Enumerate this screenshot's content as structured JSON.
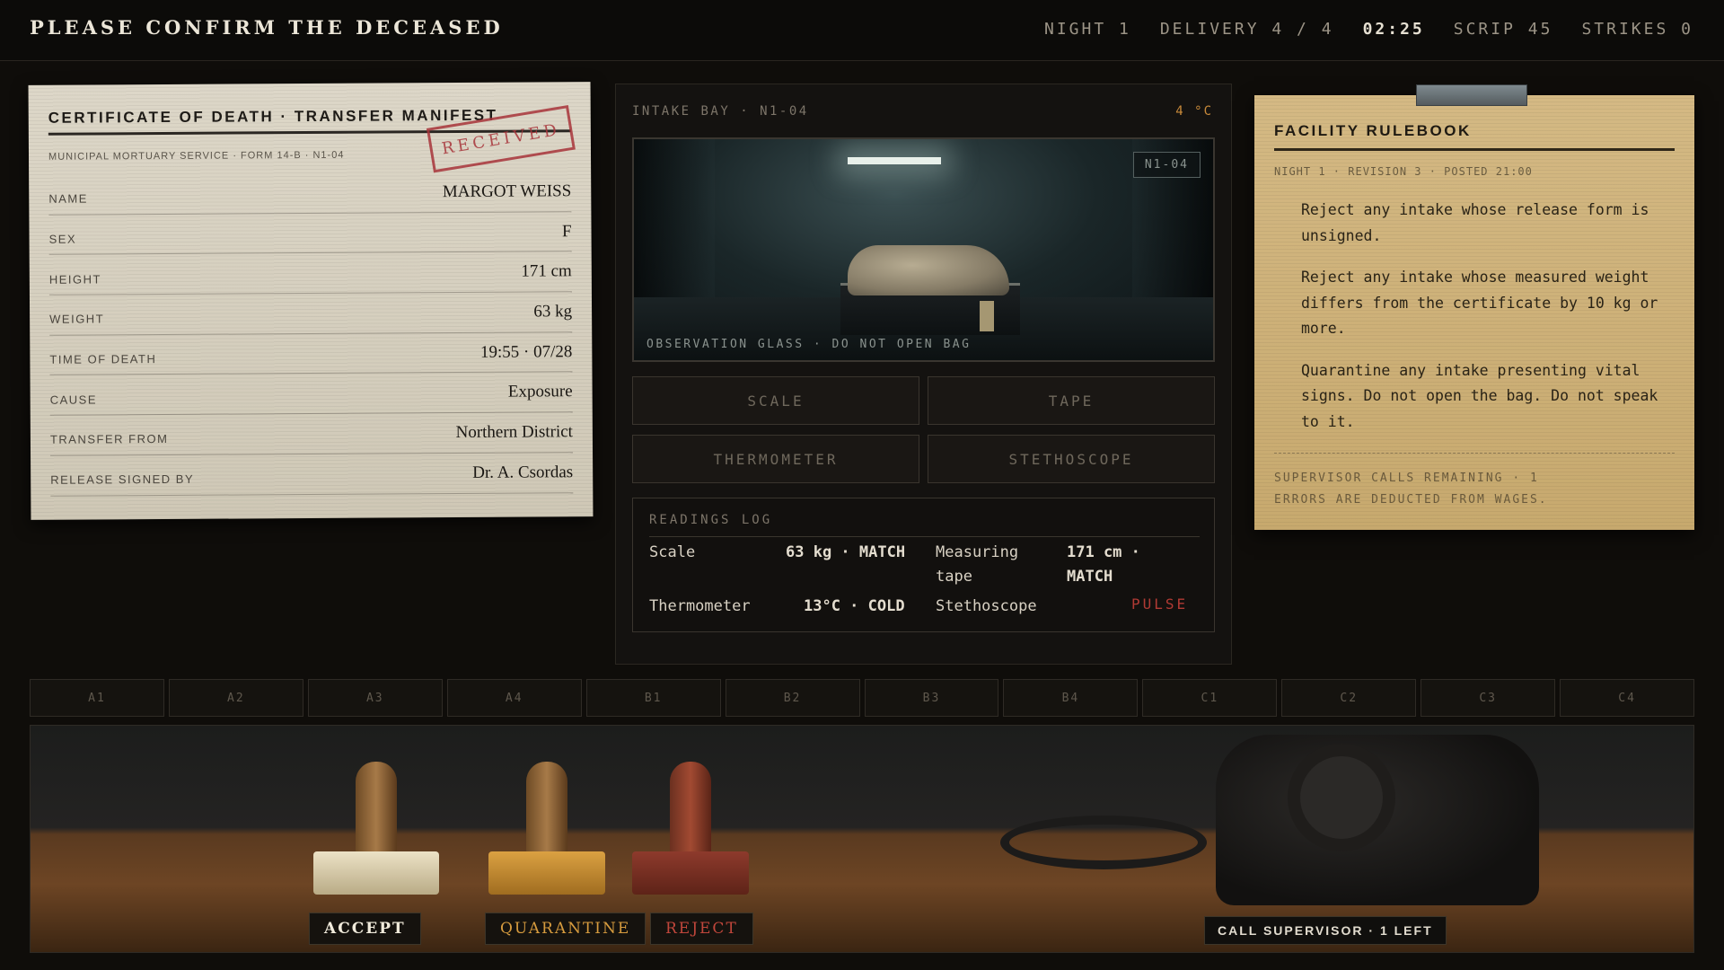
{
  "header": {
    "title": "PLEASE CONFIRM THE DECEASED",
    "night": "NIGHT 1",
    "delivery": "DELIVERY 4 / 4",
    "time": "02:25",
    "scrip": "SCRIP 45",
    "strikes": "STRIKES 0"
  },
  "certificate": {
    "heading": "CERTIFICATE OF DEATH · TRANSFER MANIFEST",
    "subheading": "MUNICIPAL MORTUARY SERVICE · FORM 14-B · N1-04",
    "stamp": "RECEIVED",
    "rows": [
      {
        "label": "NAME",
        "value": "MARGOT WEISS"
      },
      {
        "label": "SEX",
        "value": "F"
      },
      {
        "label": "HEIGHT",
        "value": "171 cm"
      },
      {
        "label": "WEIGHT",
        "value": "63 kg"
      },
      {
        "label": "TIME OF DEATH",
        "value": "19:55 · 07/28"
      },
      {
        "label": "CAUSE",
        "value": "Exposure"
      },
      {
        "label": "TRANSFER FROM",
        "value": "Northern District"
      },
      {
        "label": "RELEASE SIGNED BY",
        "value": "Dr. A. Csordas"
      }
    ]
  },
  "bay": {
    "label": "INTAKE BAY · N1-04",
    "temp": "4 °C",
    "viewport_tag": "N1-04",
    "viewport_caption": "OBSERVATION GLASS · DO NOT OPEN BAG",
    "tools": [
      "SCALE",
      "TAPE",
      "THERMOMETER",
      "STETHOSCOPE"
    ]
  },
  "readings": {
    "title": "READINGS LOG",
    "items": [
      {
        "tool": "Scale",
        "value": "63 kg · MATCH"
      },
      {
        "tool": "Measuring tape",
        "value": "171 cm · MATCH"
      },
      {
        "tool": "Thermometer",
        "value": "13°C · COLD"
      },
      {
        "tool": "Stethoscope",
        "value": "PULSE"
      }
    ]
  },
  "rulebook": {
    "heading": "FACILITY RULEBOOK",
    "subheading": "NIGHT 1 · REVISION 3 · POSTED 21:00",
    "rules": [
      "Reject any intake whose release form is unsigned.",
      "Reject any intake whose measured weight differs from the certificate by 10 kg or more.",
      "Quarantine any intake presenting vital signs. Do not open the bag. Do not speak to it."
    ],
    "footer_line1": "SUPERVISOR CALLS REMAINING · 1",
    "footer_line2": "ERRORS ARE DEDUCTED FROM WAGES."
  },
  "slots": [
    "A1",
    "A2",
    "A3",
    "A4",
    "B1",
    "B2",
    "B3",
    "B4",
    "C1",
    "C2",
    "C3",
    "C4"
  ],
  "actions": {
    "accept": "ACCEPT",
    "quarantine": "QUARANTINE",
    "reject": "REJECT",
    "call": "CALL SUPERVISOR · 1 LEFT"
  },
  "colors": {
    "accent_amber": "#d69b3e",
    "alert_red": "#c0463b",
    "paper": "#d6d0c0",
    "rulebook_paper": "#cdb27a"
  }
}
